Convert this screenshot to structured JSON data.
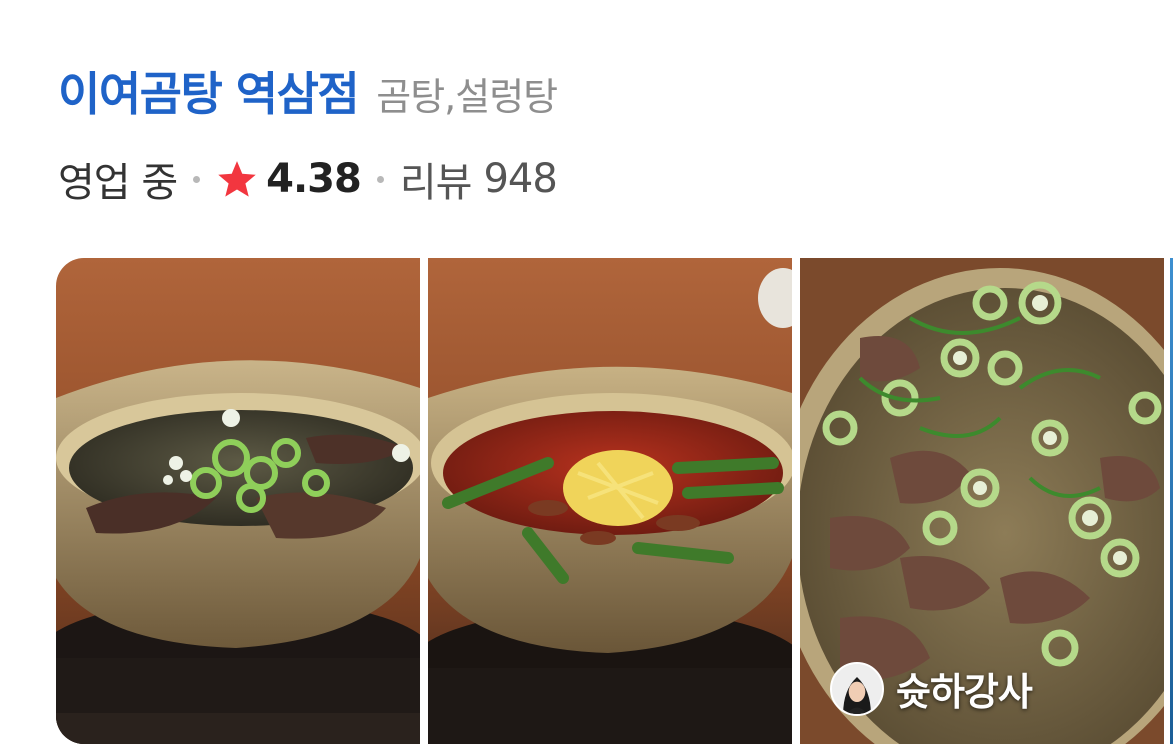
{
  "place": {
    "name": "이여곰탕 역삼점",
    "category": "곰탕,설렁탕"
  },
  "meta": {
    "status": "영업 중",
    "rating": "4.38",
    "review_label": "리뷰",
    "review_count": "948"
  },
  "icons": {
    "star": "star-icon",
    "separator": "dot-separator"
  },
  "colors": {
    "title": "#1f63c8",
    "star": "#f2363f",
    "category": "#8e8e8e"
  },
  "photos": [
    {
      "subject": "gomtang-bowl"
    },
    {
      "subject": "yukgaejang-bowl"
    },
    {
      "subject": "gomtang-closeup",
      "author": "슛하강사"
    },
    {
      "subject": "partial-photo"
    }
  ]
}
